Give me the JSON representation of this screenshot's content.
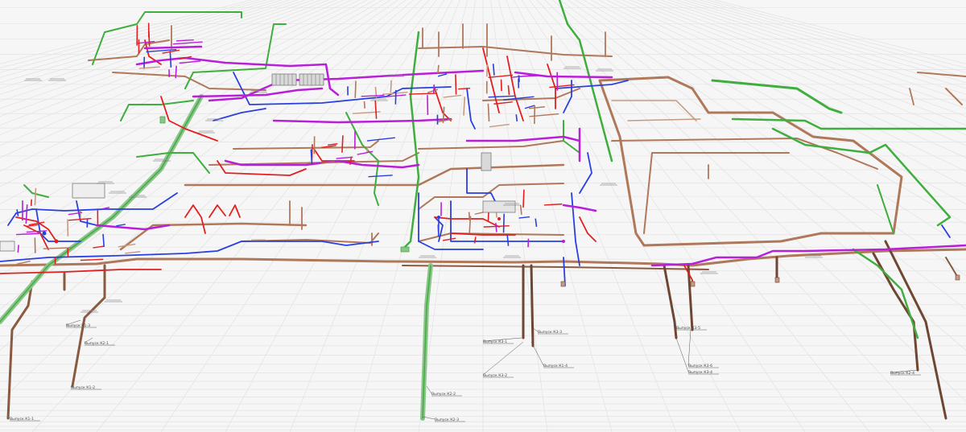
{
  "colors": {
    "background": "#f6f6f6",
    "grid": "#dcdcdc",
    "sewer_pipe": "#b0785a",
    "sewer_pipe_dark": "#6e4632",
    "stormwater_pipe": "#3fae3f",
    "cold_water_pipe": "#2a3fe0",
    "hot_water_pipe": "#e02020",
    "circulation_pipe": "#b820d8",
    "leader_line": "#444444"
  },
  "icons": [
    "riser-icon",
    "valve-icon",
    "equipment-block-icon"
  ],
  "riser_labels": [
    "Выпуск К1-1",
    "Выпуск К1-2",
    "Выпуск К1-3",
    "Выпуск К2-1",
    "Выпуск К2-2",
    "Выпуск К2-3",
    "Выпуск К3-1",
    "Выпуск К3-2",
    "Выпуск К3-3",
    "Выпуск К1-4",
    "Выпуск К3-4",
    "Выпуск К3-5",
    "Выпуск К3-6",
    "Выпуск К2-4"
  ]
}
